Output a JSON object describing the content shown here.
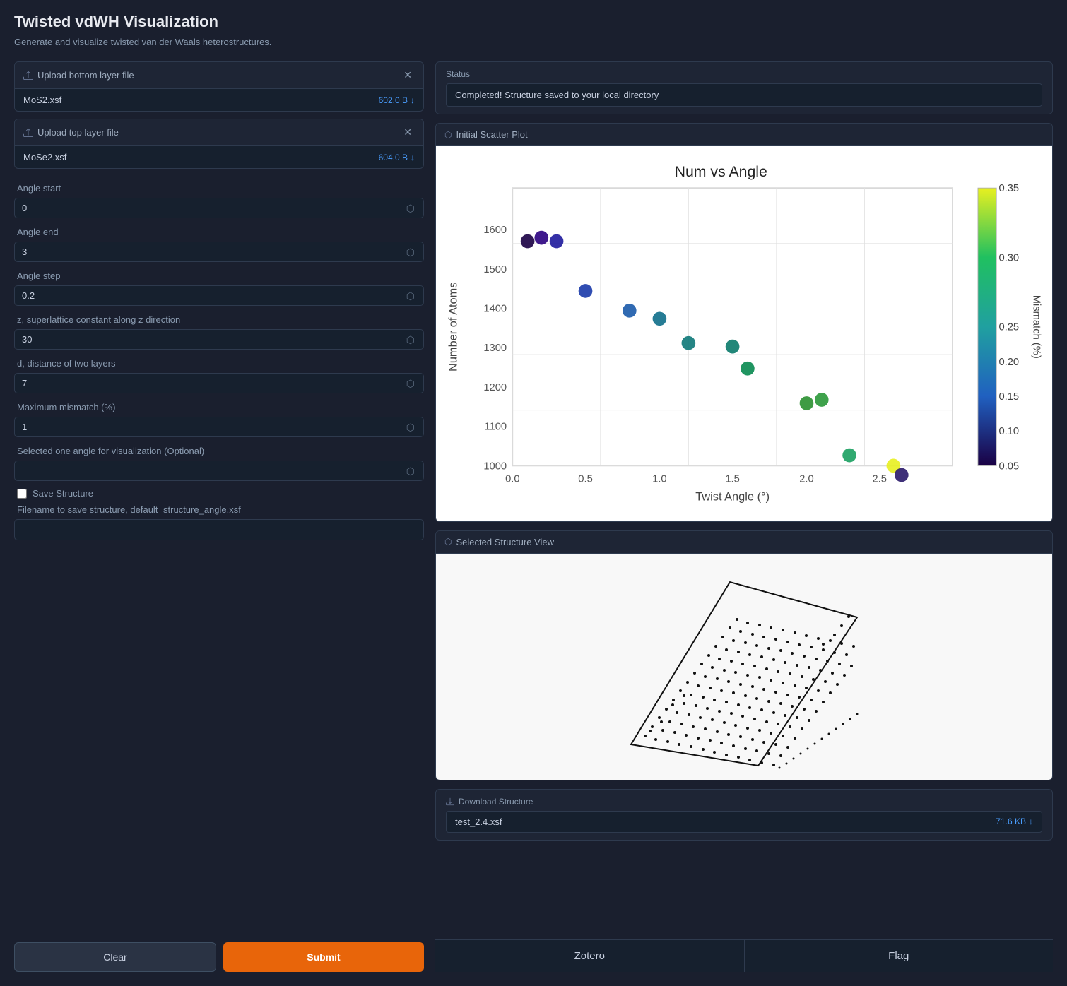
{
  "app": {
    "title": "Twisted vdWH Visualization",
    "subtitle": "Generate and visualize twisted van der Waals heterostructures."
  },
  "upload_bottom": {
    "label": "Upload bottom layer file",
    "filename": "MoS2.xsf",
    "filesize": "602.0 B",
    "arrow": "↓"
  },
  "upload_top": {
    "label": "Upload top layer file",
    "filename": "MoSe2.xsf",
    "filesize": "604.0 B",
    "arrow": "↓"
  },
  "params": {
    "angle_start_label": "Angle start",
    "angle_start_value": "0",
    "angle_end_label": "Angle end",
    "angle_end_value": "3",
    "angle_step_label": "Angle step",
    "angle_step_value": "0.2",
    "z_label": "z, superlattice constant along z direction",
    "z_value": "30",
    "d_label": "d, distance of two layers",
    "d_value": "7",
    "mismatch_label": "Maximum mismatch (%)",
    "mismatch_value": "1",
    "angle_viz_label": "Selected one angle for visualization (Optional)",
    "angle_viz_value": "",
    "save_structure_label": "Save Structure",
    "filename_label": "Filename to save structure, default=structure_angle.xsf",
    "filename_value": ""
  },
  "buttons": {
    "clear": "Clear",
    "submit": "Submit"
  },
  "status": {
    "label": "Status",
    "message": "Completed! Structure saved to your local directory"
  },
  "scatter_plot": {
    "section_label": "Initial Scatter Plot",
    "title": "Num vs Angle",
    "x_label": "Twist Angle (°)",
    "y_label": "Number of Atoms",
    "colorbar_label": "Mismatch (%)"
  },
  "structure_view": {
    "section_label": "Selected Structure View"
  },
  "download": {
    "label": "Download Structure",
    "filename": "test_2.4.xsf",
    "filesize": "71.6 KB",
    "arrow": "↓"
  },
  "tabs": [
    {
      "label": "Zotero"
    },
    {
      "label": "Flag"
    }
  ]
}
